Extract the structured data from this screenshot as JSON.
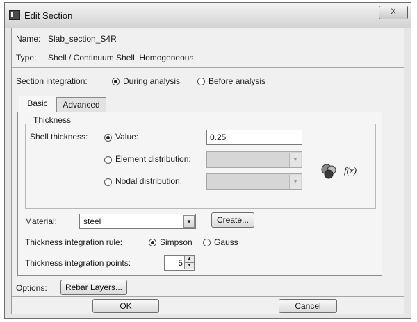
{
  "window": {
    "title": "Edit Section",
    "close_label": "X"
  },
  "info": {
    "name_label": "Name:",
    "name_value": "Slab_section_S4R",
    "type_label": "Type:",
    "type_value": "Shell / Continuum Shell, Homogeneous"
  },
  "integration": {
    "label": "Section integration:",
    "options": [
      "During analysis",
      "Before analysis"
    ],
    "selected": "During analysis"
  },
  "tabs": [
    {
      "label": "Basic"
    },
    {
      "label": "Advanced"
    }
  ],
  "thickness": {
    "group_title": "Thickness",
    "shell_label": "Shell thickness:",
    "value_label": "Value:",
    "value": "0.25",
    "element_dist_label": "Element distribution:",
    "nodal_dist_label": "Nodal distribution:",
    "fx_label": "f(x)"
  },
  "material": {
    "label": "Material:",
    "value": "steel",
    "create_label": "Create..."
  },
  "rule": {
    "label": "Thickness integration rule:",
    "options": [
      "Simpson",
      "Gauss"
    ],
    "selected": "Simpson"
  },
  "points": {
    "label": "Thickness integration points:",
    "value": "5"
  },
  "options": {
    "label": "Options:",
    "rebar_label": "Rebar Layers..."
  },
  "footer": {
    "ok_label": "OK",
    "cancel_label": "Cancel"
  },
  "icons": [
    "window-icon",
    "close-icon",
    "function-tool-icon",
    "dropdown-arrow-icon",
    "spin-up-icon",
    "spin-down-icon"
  ]
}
